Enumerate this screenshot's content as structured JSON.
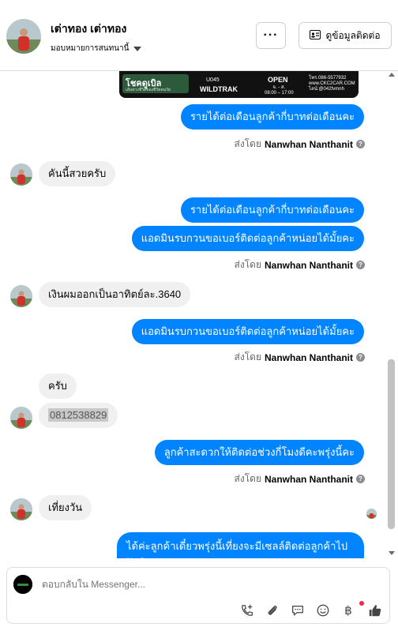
{
  "header": {
    "contact_name": "เต่าทอง เต่าทอง",
    "assign_label": "มอบหมายการสนทนานี้",
    "more_label": "···",
    "contact_info_label": "ดูข้อมูลติดต่อ"
  },
  "banner": {
    "brand": "โชคดูเบิล",
    "brand_sub": "เส้นทางชีวิตของชีวิตคนวัย",
    "code": "U045",
    "model": "WILDTRAK",
    "open_label": "OPEN",
    "hours_line1": "จ. - ส.",
    "hours_line2": "08:00 – 17:00",
    "tel_line1": "โทร.086-5577932",
    "tel_line2": "www.CKC2CAR.COM",
    "tel_line3": "ไลน์:@042fvmnh"
  },
  "messages": {
    "m1": "รายได้ต่อเดือนลูกค้ากี่บาทต่อเดือนคะ",
    "sent1_prefix": "ส่งโดย",
    "sent1_name": "Nanwhan Nanthanit",
    "m2": "คันนี้สวยครับ",
    "m3": "รายได้ต่อเดือนลูกค้ากี่บาทต่อเดือนคะ",
    "m4": "แอดมินรบกวนขอเบอร์ติดต่อลูกค้าหน่อยได้มั้ยคะ",
    "sent2_prefix": "ส่งโดย",
    "sent2_name": "Nanwhan Nanthanit",
    "m5": "เงินผมออกเป็นอาทิตย์ละ.3640",
    "m6": "แอดมินรบกวนขอเบอร์ติดต่อลูกค้าหน่อยได้มั้ยคะ",
    "sent3_prefix": "ส่งโดย",
    "sent3_name": "Nanwhan Nanthanit",
    "m7": "ครับ",
    "m8": "0812538829",
    "m9": "ลูกค้าสะดวกให้ติดต่อช่วงกี่โมงดีคะพรุ่งนี้คะ",
    "sent4_prefix": "ส่งโดย",
    "sent4_name": "Nanwhan Nanthanit",
    "m10": "เที่ยงวัน",
    "m11": "ได้ค่ะลูกค้าเดี๋ยวพรุ่งนี้เที่ยงจะมีเซลล์ติดต่อลูกค้าไปนะคะ"
  },
  "composer": {
    "placeholder": "ตอบกลับใน Messenger...",
    "baht": "฿"
  },
  "colors": {
    "outgoing": "#0084ff",
    "incoming": "#f0f0f0",
    "like": "#050505"
  },
  "icons": [
    "add-call-icon",
    "attachment-icon",
    "saved-reply-icon",
    "emoji-icon",
    "baht-icon",
    "like-icon",
    "info-icon",
    "chevron-down-icon"
  ]
}
